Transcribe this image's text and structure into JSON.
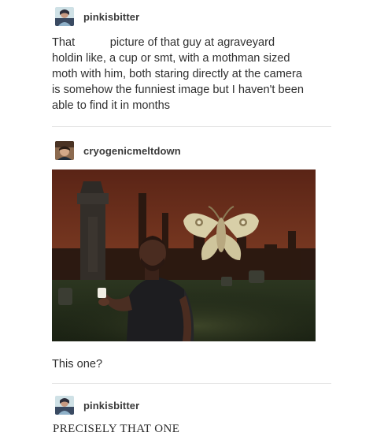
{
  "posts": [
    {
      "username": "pinkisbitter",
      "avatar_icon": "user-avatar-icon",
      "text": "That           picture of that guy at agraveyard\nholdin like, a cup or smt, with a mothman sized\nmoth with him, both staring directly at the camera\nis somehow the funniest image but I haven't been\nable to find it in months"
    },
    {
      "username": "cryogenicmeltdown",
      "avatar_icon": "user-avatar-icon",
      "image_icon": "photo-graveyard-moth-icon",
      "caption": "This one?"
    },
    {
      "username": "pinkisbitter",
      "avatar_icon": "user-avatar-icon",
      "text": "PRECISELY THAT ONE"
    }
  ],
  "colors": {
    "text": "#2f2f2f",
    "divider": "#e6e6e6",
    "sky": "#6b2f1c",
    "ground": "#1f2a17"
  }
}
